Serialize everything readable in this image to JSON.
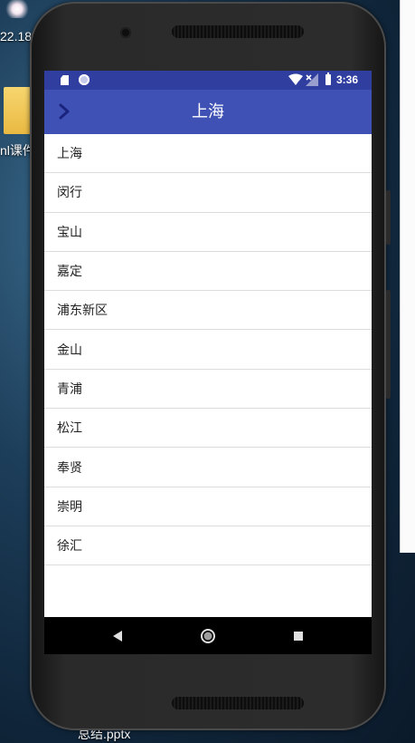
{
  "desktop": {
    "time_fragment": "22.18",
    "folder_label": "nl课件",
    "file_label": "总结.pptx"
  },
  "status_bar": {
    "time": "3:36",
    "color": "#303f9f"
  },
  "app_bar": {
    "title": "上海",
    "color": "#3f51b5",
    "back_icon": "chevron-right-icon"
  },
  "list": {
    "items": [
      {
        "label": "上海"
      },
      {
        "label": "闵行"
      },
      {
        "label": "宝山"
      },
      {
        "label": "嘉定"
      },
      {
        "label": "浦东新区"
      },
      {
        "label": "金山"
      },
      {
        "label": "青浦"
      },
      {
        "label": "松江"
      },
      {
        "label": "奉贤"
      },
      {
        "label": "崇明"
      },
      {
        "label": "徐汇"
      }
    ]
  },
  "nav_bar": {
    "back_icon": "triangle-back-icon",
    "home_icon": "circle-home-icon",
    "recents_icon": "square-recents-icon"
  }
}
